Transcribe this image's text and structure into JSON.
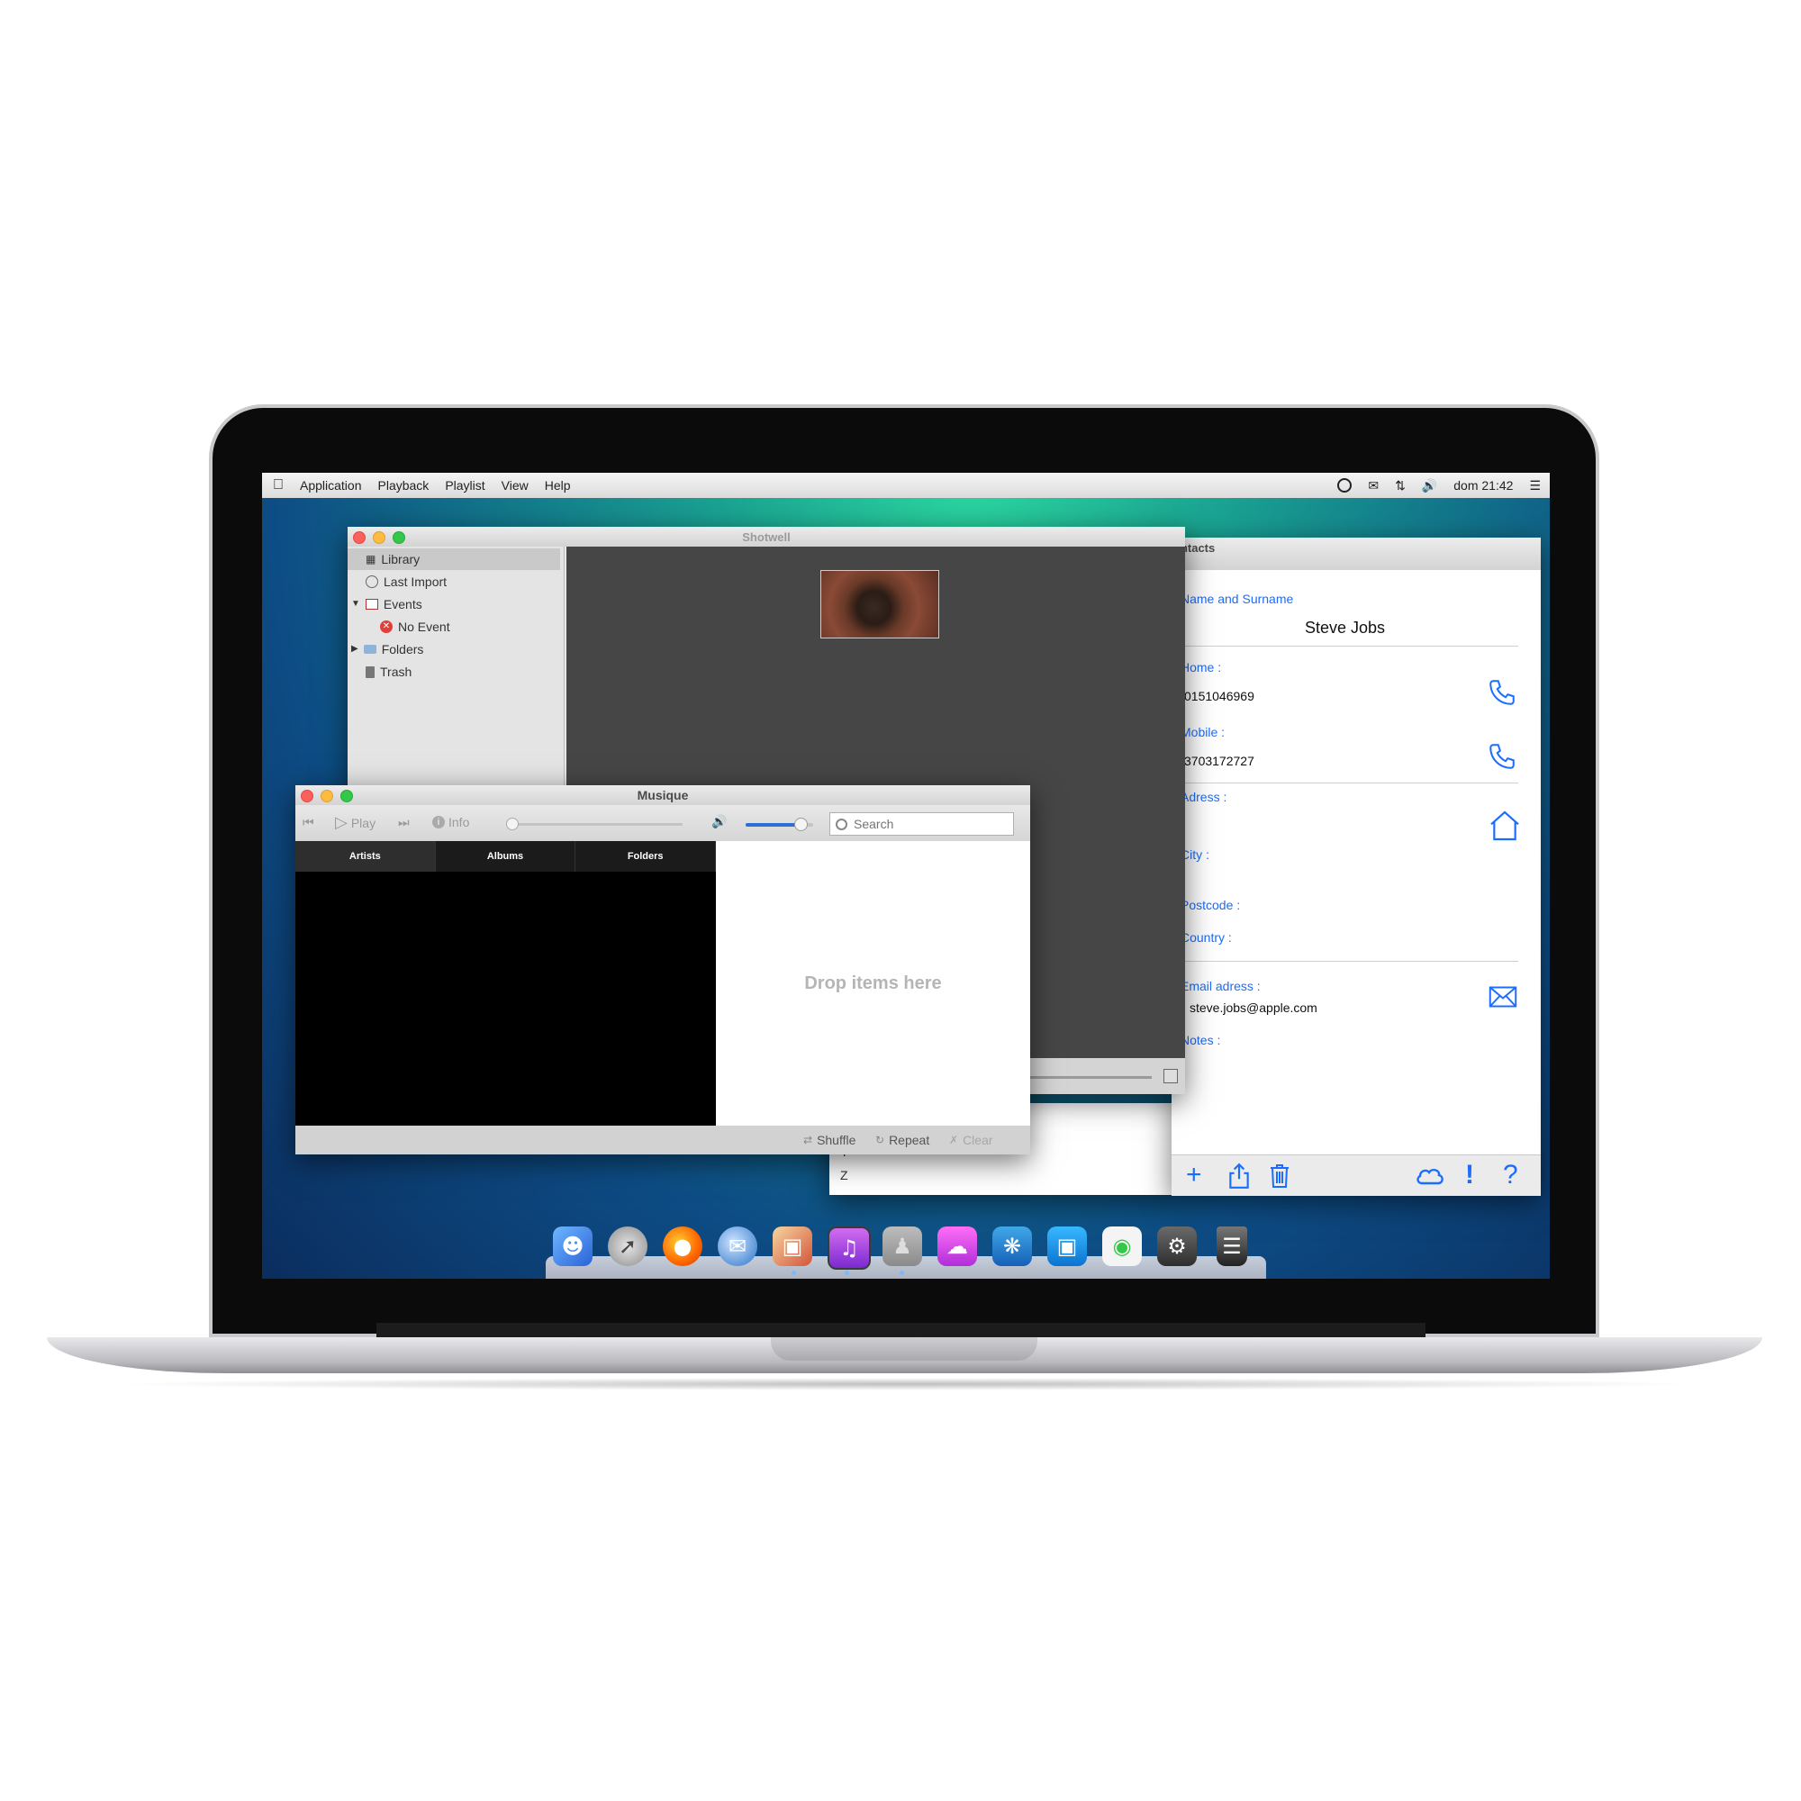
{
  "menubar": {
    "items": [
      "Application",
      "Playback",
      "Playlist",
      "View",
      "Help"
    ],
    "clock": "dom 21:42"
  },
  "shotwell": {
    "title": "Shotwell",
    "sidebar": [
      "Library",
      "Last Import",
      "Events",
      "No Event",
      "Folders",
      "Trash"
    ]
  },
  "musique": {
    "title": "Musique",
    "play_label": "Play",
    "info_label": "Info",
    "search_placeholder": "Search",
    "tabs": [
      "Artists",
      "Albums",
      "Folders"
    ],
    "drop_text": "Drop items here",
    "shuffle_label": "Shuffle",
    "repeat_label": "Repeat",
    "clear_label": "Clear",
    "volume_fraction": 0.8,
    "seek_fraction": 0.0
  },
  "contacts": {
    "title": "ontacts",
    "name_label": "Name and Surname",
    "name_value": "Steve Jobs",
    "home_label": "Home :",
    "home_value": "0151046969",
    "mobile_label": "Mobile :",
    "mobile_value": "3703172727",
    "address_label": "Adress :",
    "city_label": "City :",
    "postcode_label": "Postcode :",
    "country_label": "Country :",
    "email_label": "Email adress :",
    "email_value": "steve.jobs@apple.com",
    "notes_label": "Notes :",
    "list_letters": [
      "Y",
      "Z"
    ]
  },
  "dock": {
    "apps": [
      "finder-icon",
      "launchpad-icon",
      "firefox-icon",
      "thunderbird-icon",
      "shotwell-icon",
      "music-icon",
      "contacts-icon",
      "icloud-icon",
      "app-store-icon",
      "screen-icon",
      "toggle-settings-icon",
      "system-settings-icon",
      "trash-icon"
    ]
  },
  "colors": {
    "accent": "#1a6dff",
    "desktop_top": "#2bd7a0",
    "desktop_bottom": "#0b2d5e"
  }
}
